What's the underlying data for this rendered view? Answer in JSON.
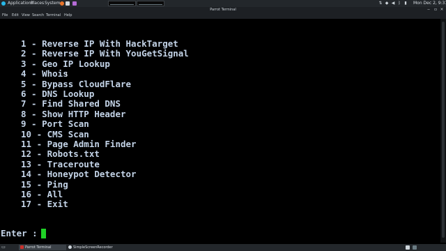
{
  "top_panel": {
    "applications": "Applications",
    "places": "Places",
    "system": "System",
    "clock": "Mon Dec 2,  9:31 AM"
  },
  "window": {
    "title": "Parrot Terminal"
  },
  "menubar": {
    "file": "File",
    "edit": "Edit",
    "view": "View",
    "search": "Search",
    "terminal": "Terminal",
    "help": "Help"
  },
  "terminal": {
    "menu": [
      "1 - Reverse IP With HackTarget",
      "2 - Reverse IP With YouGetSignal",
      "3 - Geo IP Lookup",
      "4 - Whois",
      "5 - Bypass CloudFlare",
      "6 - DNS Lookup",
      "7 - Find Shared DNS",
      "8 - Show HTTP Header",
      "9 - Port Scan",
      "10 - CMS Scan",
      "11 - Page Admin Finder",
      "12 - Robots.txt",
      "13 - Traceroute",
      "14 - Honeypot Detector",
      "15 - Ping",
      "16 - All",
      "17 - Exit"
    ],
    "prompt": "Enter : "
  },
  "taskbar": {
    "task1": "Parrot Terminal",
    "task2": "SimpleScreenRecorder"
  },
  "colors": {
    "terminal_text": "#c4d4e8",
    "cursor": "#1fd126",
    "panel_bg": "#23272b"
  }
}
